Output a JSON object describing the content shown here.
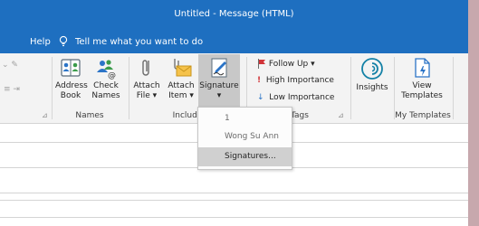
{
  "window": {
    "title": "Untitled  -  Message (HTML)"
  },
  "menubar": {
    "help": "Help",
    "tell_me": "Tell me what you want to do"
  },
  "ribbon": {
    "address_book": [
      "Address",
      "Book"
    ],
    "check_names": [
      "Check",
      "Names"
    ],
    "names_group": "Names",
    "attach_file": [
      "Attach",
      "File ▾"
    ],
    "attach_item": [
      "Attach",
      "Item ▾"
    ],
    "signature": [
      "Signature",
      "▾"
    ],
    "include_group": "Include",
    "follow_up": "Follow Up ▾",
    "high_importance": "High Importance",
    "low_importance": "Low Importance",
    "tags_group": "Tags",
    "insights": "Insights",
    "view_templates": [
      "View",
      "Templates"
    ],
    "my_templates_group": "My Templates"
  },
  "signature_menu": {
    "items": [
      "1",
      "Wong Su Ann",
      "Signatures..."
    ]
  },
  "colors": {
    "title_bar": "#1e6fc0",
    "ribbon_bg": "#f3f3f3",
    "follow_up_flag": "#d13438",
    "high_importance": "#d13438",
    "low_importance": "#2b74c7",
    "insights": "#1481a6"
  }
}
